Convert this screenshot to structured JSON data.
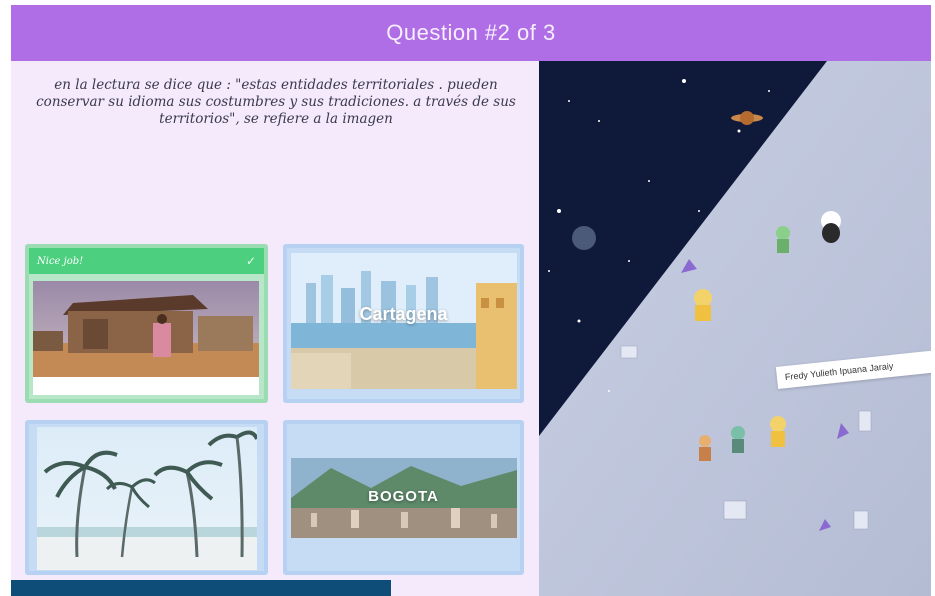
{
  "header": {
    "title": "Question #2 of 3"
  },
  "question": {
    "text": "en la lectura se dice que : \"estas entidades territoriales . pueden conservar su idioma sus costumbres y sus tradiciones. a través de sus territorios\", se refiere a la imagen"
  },
  "options": [
    {
      "feedback": "Nice job!",
      "image_text": "",
      "state": "correct"
    },
    {
      "image_text": "Cartagena"
    },
    {
      "image_text": ""
    },
    {
      "image_text": "BOGOTA"
    }
  ],
  "game": {
    "player_name": "Fredy Yulieth Ipuana Jaraiy"
  },
  "colors": {
    "header": "#b06ee6",
    "correct": "#4ccf7e",
    "option_border": "#b6d1f1",
    "bottom_bar": "#0d4d78",
    "space": "#0f1a3a"
  }
}
